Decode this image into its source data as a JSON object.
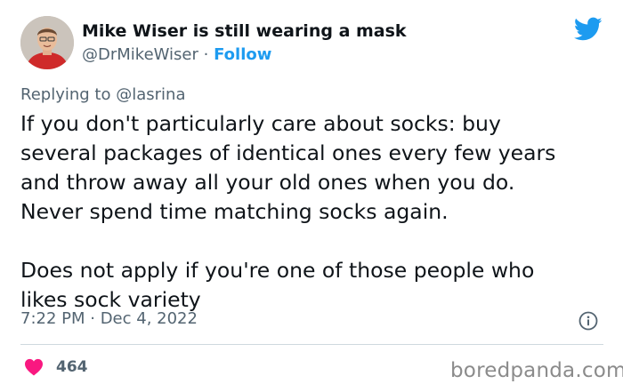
{
  "author": {
    "name": "Mike Wiser is still wearing a mask",
    "handle": "@DrMikeWiser",
    "separator": "·",
    "follow_label": "Follow"
  },
  "reply": {
    "prefix": "Replying to",
    "handle": "@lasrina"
  },
  "tweet": {
    "lines": [
      "If you don't particularly care about socks: buy",
      "several packages of identical ones every few years",
      "and throw away all your old ones when you do.",
      "Never spend time matching socks again.",
      "",
      "Does not apply if you're one of those people who",
      "likes sock variety"
    ]
  },
  "meta": {
    "timestamp": "7:22 PM · Dec 4, 2022"
  },
  "engagement": {
    "likes": "464"
  },
  "watermark": "boredpanda.com",
  "colors": {
    "brand": "#1d9bf0",
    "like": "#f91880",
    "secondary_text": "#536471"
  },
  "icons": {
    "logo": "twitter-bird-icon",
    "info": "info-icon",
    "like": "heart-icon"
  }
}
